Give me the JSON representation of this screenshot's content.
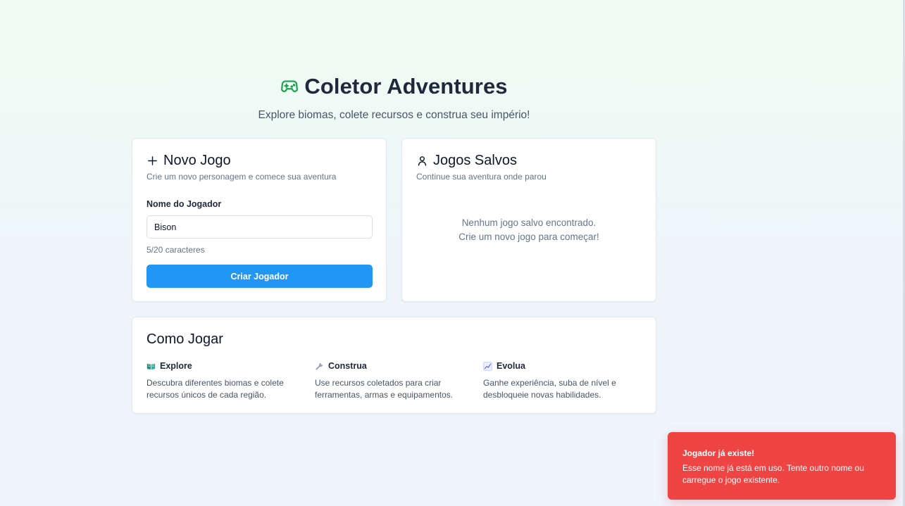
{
  "header": {
    "title": "Coletor Adventures",
    "subtitle": "Explore biomas, colete recursos e construa seu império!",
    "icon": "gamepad-icon",
    "accent_color": "#16a34a"
  },
  "new_game": {
    "title": "Novo Jogo",
    "icon": "plus-icon",
    "description": "Crie um novo personagem e comece sua aventura",
    "field_label": "Nome do Jogador",
    "field_value": "Bison",
    "char_count": "5/20 caracteres",
    "button_label": "Criar Jogador",
    "button_color": "#2196f3"
  },
  "saved_games": {
    "title": "Jogos Salvos",
    "icon": "user-icon",
    "description": "Continue sua aventura onde parou",
    "empty_line1": "Nenhum jogo salvo encontrado.",
    "empty_line2": "Crie um novo jogo para começar!"
  },
  "how_to_play": {
    "title": "Como Jogar",
    "tips": [
      {
        "icon": "book-icon",
        "title": "Explore",
        "text": "Descubra diferentes biomas e colete recursos únicos de cada região."
      },
      {
        "icon": "wrench-icon",
        "title": "Construa",
        "text": "Use recursos coletados para criar ferramentas, armas e equipamentos."
      },
      {
        "icon": "chart-up-icon",
        "title": "Evolua",
        "text": "Ganhe experiência, suba de nível e desbloqueie novas habilidades."
      }
    ]
  },
  "toast": {
    "title": "Jogador já existe!",
    "message": "Esse nome já está em uso. Tente outro nome ou carregue o jogo existente.",
    "color": "#ef4444"
  }
}
